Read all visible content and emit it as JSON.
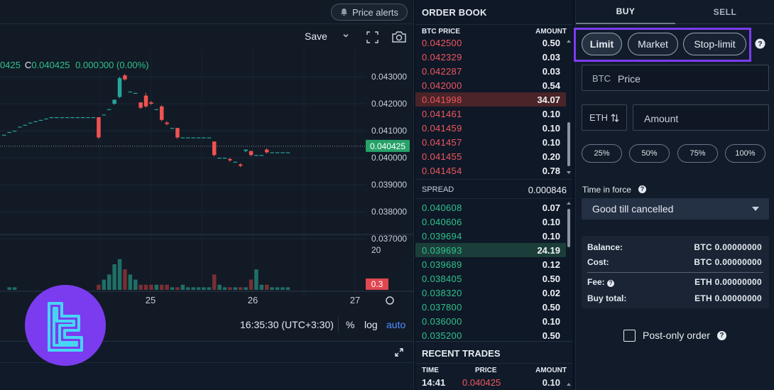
{
  "chart": {
    "price_alerts_label": "Price alerts",
    "save_label": "Save",
    "ohlc": {
      "partial_value": "0425",
      "close_label": "C",
      "close_value": "0.040425",
      "change": "0.000000 (0.00%)"
    },
    "y_ticks": [
      "0.043000",
      "0.042000",
      "0.041000",
      "0.040000",
      "0.039000",
      "0.038000",
      "0.037000"
    ],
    "current_price": "0.040425",
    "volume_tick": "20",
    "volume_badge": "0.3",
    "x_ticks": [
      "25",
      "26",
      "27"
    ],
    "time_display": "16:35:30 (UTC+3:30)",
    "pct_label": "%",
    "log_label": "log",
    "auto_label": "auto",
    "colors": {
      "up": "#26a69a",
      "down": "#ef5350"
    }
  },
  "chart_data": {
    "type": "candlestick",
    "y_axis": {
      "min": 0.037,
      "max": 0.043,
      "ticks": [
        "0.043000",
        "0.042000",
        "0.041000",
        "0.040000",
        "0.039000",
        "0.038000",
        "0.037000"
      ]
    },
    "x_ticks": [
      "25",
      "26",
      "27"
    ],
    "current_price": 0.040425,
    "candles": [
      {
        "o": 0.04085,
        "c": 0.04085,
        "h": 0.04085,
        "l": 0.04085
      },
      {
        "o": 0.04095,
        "c": 0.04095,
        "h": 0.04095,
        "l": 0.04095
      },
      {
        "o": 0.041,
        "c": 0.041,
        "h": 0.041,
        "l": 0.041
      },
      {
        "o": 0.04115,
        "c": 0.04115,
        "h": 0.04115,
        "l": 0.04115
      },
      {
        "o": 0.04122,
        "c": 0.04122,
        "h": 0.04122,
        "l": 0.04122
      },
      {
        "o": 0.0413,
        "c": 0.0413,
        "h": 0.0413,
        "l": 0.0413
      },
      {
        "o": 0.04135,
        "c": 0.04135,
        "h": 0.04135,
        "l": 0.04135
      },
      {
        "o": 0.0414,
        "c": 0.0414,
        "h": 0.0414,
        "l": 0.0414
      },
      {
        "o": 0.04145,
        "c": 0.04145,
        "h": 0.04145,
        "l": 0.04145
      },
      {
        "o": 0.0415,
        "c": 0.0415,
        "h": 0.0415,
        "l": 0.0415
      },
      {
        "o": 0.0415,
        "c": 0.0415,
        "h": 0.0415,
        "l": 0.0415
      },
      {
        "o": 0.0415,
        "c": 0.0415,
        "h": 0.0415,
        "l": 0.0415
      },
      {
        "o": 0.0415,
        "c": 0.0415,
        "h": 0.0415,
        "l": 0.0415
      },
      {
        "o": 0.0415,
        "c": 0.0415,
        "h": 0.0415,
        "l": 0.0415
      },
      {
        "o": 0.0415,
        "c": 0.0415,
        "h": 0.0415,
        "l": 0.0415
      },
      {
        "o": 0.0415,
        "c": 0.0415,
        "h": 0.0415,
        "l": 0.0415
      },
      {
        "o": 0.0415,
        "c": 0.0415,
        "h": 0.0415,
        "l": 0.0415
      },
      {
        "o": 0.0415,
        "c": 0.0415,
        "h": 0.0415,
        "l": 0.0415
      },
      {
        "o": 0.0415,
        "c": 0.04075,
        "h": 0.0415,
        "l": 0.0407
      },
      {
        "o": 0.0416,
        "c": 0.0416,
        "h": 0.0416,
        "l": 0.0416
      },
      {
        "o": 0.0418,
        "c": 0.0418,
        "h": 0.0418,
        "l": 0.0418
      },
      {
        "o": 0.042,
        "c": 0.04215,
        "h": 0.04215,
        "l": 0.04195
      },
      {
        "o": 0.04225,
        "c": 0.04295,
        "h": 0.043,
        "l": 0.0422
      },
      {
        "o": 0.04305,
        "c": 0.0429,
        "h": 0.0431,
        "l": 0.04285
      },
      {
        "o": 0.04245,
        "c": 0.04245,
        "h": 0.04245,
        "l": 0.04245
      },
      {
        "o": 0.0424,
        "c": 0.0424,
        "h": 0.0424,
        "l": 0.0424
      },
      {
        "o": 0.04205,
        "c": 0.04185,
        "h": 0.04205,
        "l": 0.0418
      },
      {
        "o": 0.0423,
        "c": 0.0419,
        "h": 0.0424,
        "l": 0.04185
      },
      {
        "o": 0.04205,
        "c": 0.042,
        "h": 0.0421,
        "l": 0.04195
      },
      {
        "o": 0.0418,
        "c": 0.0418,
        "h": 0.0418,
        "l": 0.0418
      },
      {
        "o": 0.0419,
        "c": 0.0414,
        "h": 0.04195,
        "l": 0.04135
      },
      {
        "o": 0.0413,
        "c": 0.04125,
        "h": 0.04135,
        "l": 0.0412
      },
      {
        "o": 0.0411,
        "c": 0.0411,
        "h": 0.0411,
        "l": 0.0411
      },
      {
        "o": 0.0411,
        "c": 0.04075,
        "h": 0.0411,
        "l": 0.0407
      },
      {
        "o": 0.04075,
        "c": 0.04075,
        "h": 0.04075,
        "l": 0.04075
      },
      {
        "o": 0.04075,
        "c": 0.04075,
        "h": 0.04075,
        "l": 0.04075
      },
      {
        "o": 0.04075,
        "c": 0.04075,
        "h": 0.04075,
        "l": 0.04075
      },
      {
        "o": 0.04075,
        "c": 0.04075,
        "h": 0.04075,
        "l": 0.04075
      },
      {
        "o": 0.04075,
        "c": 0.04075,
        "h": 0.04075,
        "l": 0.04075
      },
      {
        "o": 0.04075,
        "c": 0.04075,
        "h": 0.04075,
        "l": 0.04075
      },
      {
        "o": 0.0406,
        "c": 0.0401,
        "h": 0.0406,
        "l": 0.04005
      },
      {
        "o": 0.04,
        "c": 0.04,
        "h": 0.04,
        "l": 0.04
      },
      {
        "o": 0.04,
        "c": 0.04,
        "h": 0.04,
        "l": 0.04
      },
      {
        "o": 0.03995,
        "c": 0.0399,
        "h": 0.04,
        "l": 0.03985
      },
      {
        "o": 0.03985,
        "c": 0.03985,
        "h": 0.03985,
        "l": 0.03985
      },
      {
        "o": 0.03975,
        "c": 0.0397,
        "h": 0.0398,
        "l": 0.03965
      },
      {
        "o": 0.04025,
        "c": 0.0403,
        "h": 0.0403,
        "l": 0.0402
      },
      {
        "o": 0.04025,
        "c": 0.0401,
        "h": 0.04025,
        "l": 0.04005
      },
      {
        "o": 0.0401,
        "c": 0.0401,
        "h": 0.0401,
        "l": 0.0401
      },
      {
        "o": 0.0401,
        "c": 0.0401,
        "h": 0.0401,
        "l": 0.0401
      },
      {
        "o": 0.0403,
        "c": 0.0402,
        "h": 0.04035,
        "l": 0.04015
      },
      {
        "o": 0.0402,
        "c": 0.0402,
        "h": 0.0402,
        "l": 0.0402
      },
      {
        "o": 0.0402,
        "c": 0.0402,
        "h": 0.0402,
        "l": 0.0402
      },
      {
        "o": 0.0402,
        "c": 0.0402,
        "h": 0.0402,
        "l": 0.0402
      },
      {
        "o": 0.0402,
        "c": 0.0402,
        "h": 0.0402,
        "l": 0.0402
      }
    ],
    "volume": {
      "max": 20,
      "values": [
        0,
        0.5,
        0.5,
        0,
        0,
        0,
        0,
        0,
        0,
        0,
        0,
        0,
        0,
        0,
        0,
        0,
        0,
        0,
        1,
        2,
        3,
        5,
        6,
        4,
        3,
        2,
        1,
        1,
        1,
        1,
        1,
        1,
        0.5,
        0.5,
        1,
        0.5,
        0.5,
        0.5,
        0.5,
        0.5,
        3,
        1,
        0.5,
        0.5,
        0.5,
        0.5,
        0.5,
        2,
        4,
        1,
        1,
        0.5,
        0.5,
        0.5,
        0.5
      ]
    }
  },
  "order_book": {
    "title": "ORDER BOOK",
    "price_header": "BTC PRICE",
    "amount_header": "AMOUNT",
    "asks": [
      {
        "price": "0.042500",
        "amount": "0.50"
      },
      {
        "price": "0.042329",
        "amount": "0.03"
      },
      {
        "price": "0.042287",
        "amount": "0.03"
      },
      {
        "price": "0.042000",
        "amount": "0.54"
      },
      {
        "price": "0.041998",
        "amount": "34.07"
      },
      {
        "price": "0.041461",
        "amount": "0.10"
      },
      {
        "price": "0.041459",
        "amount": "0.10"
      },
      {
        "price": "0.041457",
        "amount": "0.10"
      },
      {
        "price": "0.041455",
        "amount": "0.20"
      },
      {
        "price": "0.041454",
        "amount": "0.78"
      }
    ],
    "spread_label": "SPREAD",
    "spread_value": "0.000846",
    "bids": [
      {
        "price": "0.040608",
        "amount": "0.07"
      },
      {
        "price": "0.040606",
        "amount": "0.10"
      },
      {
        "price": "0.039694",
        "amount": "0.10"
      },
      {
        "price": "0.039693",
        "amount": "24.19"
      },
      {
        "price": "0.039689",
        "amount": "0.12"
      },
      {
        "price": "0.038405",
        "amount": "0.50"
      },
      {
        "price": "0.038320",
        "amount": "0.02"
      },
      {
        "price": "0.037800",
        "amount": "0.50"
      },
      {
        "price": "0.036000",
        "amount": "0.10"
      },
      {
        "price": "0.035200",
        "amount": "0.50"
      }
    ]
  },
  "recent_trades": {
    "title": "RECENT TRADES",
    "time_header": "TIME",
    "price_header": "PRICE",
    "amount_header": "AMOUNT",
    "rows": [
      {
        "time": "14:41",
        "price": "0.040425",
        "amount": "0.10"
      }
    ]
  },
  "order_form": {
    "buy_tab": "BUY",
    "sell_tab": "SELL",
    "types": [
      "Limit",
      "Market",
      "Stop-limit"
    ],
    "price_prefix": "BTC",
    "price_placeholder": "Price",
    "unit_label": "ETH",
    "amount_placeholder": "Amount",
    "percent_buttons": [
      "25%",
      "50%",
      "75%",
      "100%"
    ],
    "time_in_force_label": "Time in force",
    "time_in_force_value": "Good till cancelled",
    "balance_label": "Balance:",
    "balance_value": "BTC 0.00000000",
    "cost_label": "Cost:",
    "cost_value": "BTC 0.00000000",
    "fee_label": "Fee:",
    "fee_value": "ETH 0.00000000",
    "buy_total_label": "Buy total:",
    "buy_total_value": "ETH 0.00000000",
    "post_only_label": "Post-only order",
    "help_glyph": "?"
  }
}
